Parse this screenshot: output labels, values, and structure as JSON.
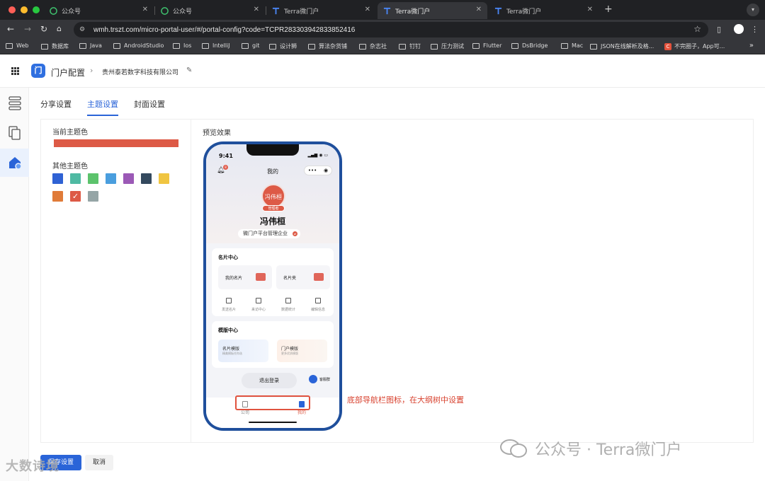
{
  "browser": {
    "tabs": [
      {
        "label": "公众号",
        "icon": "wechat-icon",
        "active": false
      },
      {
        "label": "公众号",
        "icon": "wechat-icon",
        "active": false
      },
      {
        "label": "Terra微门户",
        "icon": "terra-icon",
        "active": false
      },
      {
        "label": "Terra微门户",
        "icon": "terra-icon",
        "active": true
      },
      {
        "label": "Terra微门户",
        "icon": "terra-icon",
        "active": false
      }
    ],
    "url": "wmh.trszt.com/micro-portal-user/#/portal-config?code=TCPR283303942833852416",
    "bookmarks": [
      "Web",
      "数据库",
      "Java",
      "AndroidStudio",
      "Ios",
      "IntelliJ",
      "git",
      "设计狮",
      "算法杂货铺",
      "杂志社",
      "钉钉",
      "压力测试",
      "Flutter",
      "DsBridge",
      "Mac",
      "JSON在线解析及格...",
      "不完圈子，App可..."
    ]
  },
  "header": {
    "title": "门户配置",
    "company": "贵州泰若数字科技有限公司"
  },
  "rail": [
    "list-icon",
    "pages-icon",
    "home-theme-icon"
  ],
  "tabs": [
    {
      "label": "分享设置",
      "active": false
    },
    {
      "label": "主题设置",
      "active": true
    },
    {
      "label": "封面设置",
      "active": false
    }
  ],
  "theme": {
    "current_label": "当前主题色",
    "current_color": "#dd5a46",
    "others_label": "其他主题色",
    "swatches": [
      "#2f62d4",
      "#4fbaa3",
      "#5cc36c",
      "#4a9ede",
      "#9b59b6",
      "#34495e",
      "#f0c541",
      "#e07b39",
      "#dd5a46",
      "#95a5a6"
    ],
    "selected_index": 8
  },
  "preview": {
    "label": "预览效果",
    "time": "9:41",
    "page_title": "我的",
    "bell_count": "8",
    "avatar_text": "冯伟桓",
    "badge": "管理者",
    "user_name": "冯伟桓",
    "org": "微门户平台管理企业",
    "card_center": {
      "title": "名片中心",
      "items": [
        "我的名片",
        "名片夹"
      ],
      "actions": [
        "发送名片",
        "来访中心",
        "数据统计",
        "编辑信息"
      ]
    },
    "template_center": {
      "title": "模版中心",
      "items": [
        {
          "name": "名片模版",
          "sub": "精美模板任你选"
        },
        {
          "name": "门户模版",
          "sub": "更多优质模版"
        }
      ]
    },
    "logout": "退出登录",
    "service": "客服群",
    "tabbar": [
      "公司",
      "我的"
    ]
  },
  "annotation": "底部导航栏图标，在大纲树中设置",
  "actions": {
    "save": "保存设置",
    "cancel": "取消"
  },
  "watermarks": {
    "left": "大数诗境",
    "right": "公众号 · Terra微门户"
  }
}
